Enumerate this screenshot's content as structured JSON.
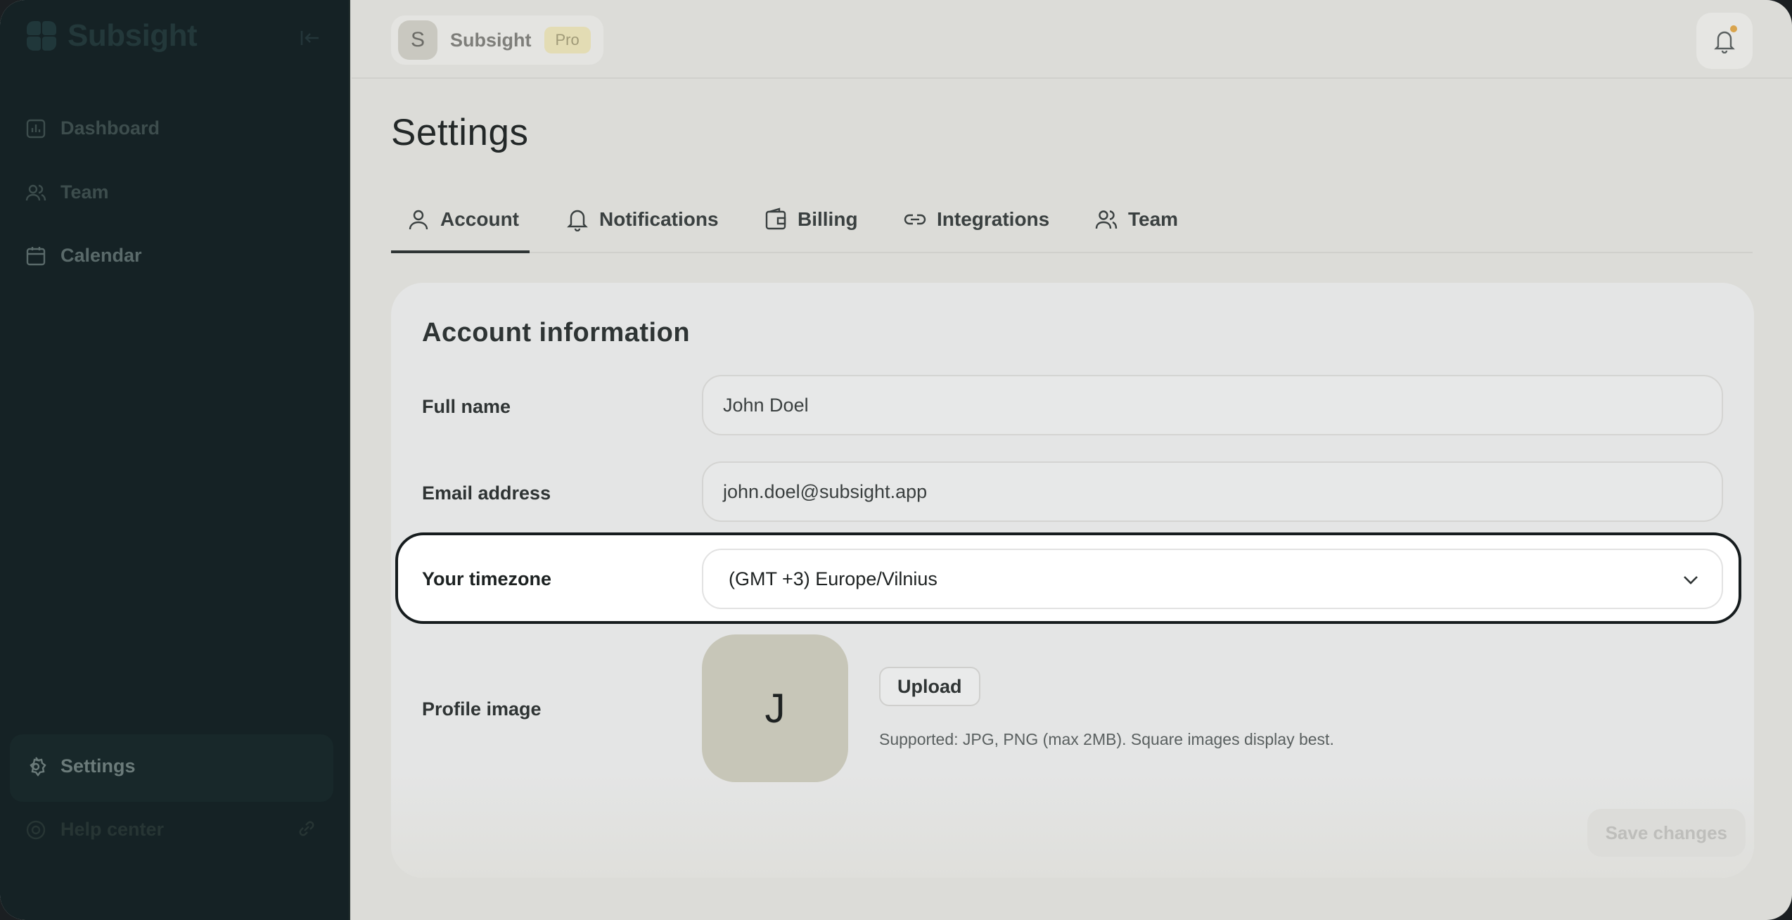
{
  "sidebar": {
    "brand": "Subsight",
    "nav": {
      "dashboard": "Dashboard",
      "team": "Team",
      "calendar": "Calendar",
      "settings": "Settings",
      "help": "Help center"
    }
  },
  "topbar": {
    "workspace_initial": "S",
    "workspace_name": "Subsight",
    "plan_badge": "Pro"
  },
  "page": {
    "title": "Settings",
    "tabs": {
      "account": "Account",
      "notifications": "Notifications",
      "billing": "Billing",
      "integrations": "Integrations",
      "team": "Team"
    },
    "active_tab": "Account"
  },
  "account": {
    "section_title": "Account information",
    "full_name_label": "Full name",
    "full_name_value": "John Doel",
    "email_label": "Email address",
    "email_value": "john.doel@subsight.app",
    "timezone_label": "Your timezone",
    "timezone_value": "(GMT +3) Europe/Vilnius",
    "profile_image_label": "Profile image",
    "avatar_initial": "J",
    "upload_label": "Upload",
    "upload_hint": "Supported: JPG, PNG (max 2MB). Square images display best.",
    "save_label": "Save changes"
  },
  "colors": {
    "sidebar_bg": "#152225",
    "page_bg": "#dcdcd8",
    "card_bg": "#e4e5e5",
    "highlight_border": "#161c1e",
    "avatar_bg": "#c7c6b8",
    "badge_bg": "#e3dcb4",
    "notification_dot": "#d9a44d"
  }
}
